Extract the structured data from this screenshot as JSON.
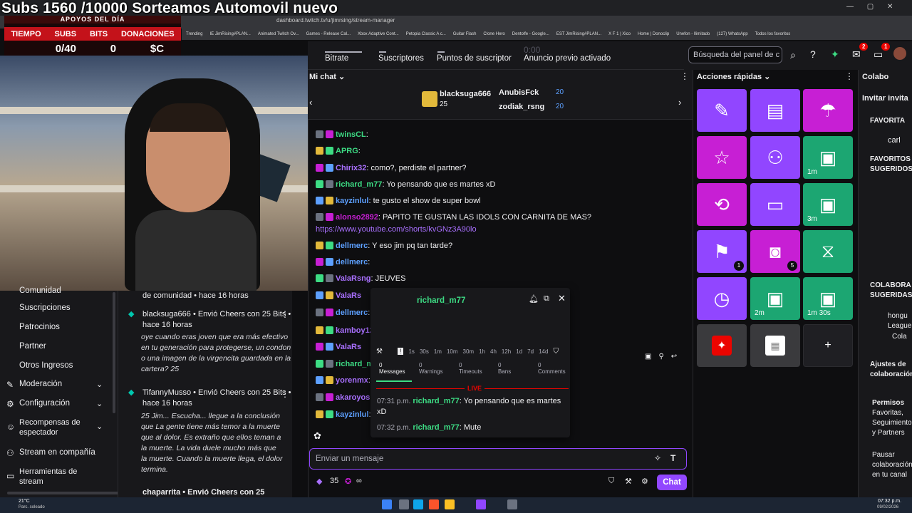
{
  "overlay": {
    "title": "Subs 1560 /10000 Sorteamos Automovil nuevo",
    "header": "APOYOS DEL DÍA",
    "labels": [
      "TIEMPO",
      "SUBS",
      "BITS",
      "DONACIONES"
    ],
    "values": [
      "",
      "0/40",
      "0",
      "$C"
    ]
  },
  "browser": {
    "url": "dashboard.twitch.tv/u/jimrsing/stream-manager",
    "bookmarks": [
      "Trending",
      "IE JimRising#PLAN...",
      "Animated Twitch Ov...",
      "Games - Release Cal...",
      "Xbox Adaptive Cont...",
      "Petopia Classic A c...",
      "Guitar Flash",
      "Clone Hero",
      "Dentolfe - Google...",
      "EST JimRising#PLAN...",
      "X F 1 | Xico",
      "Home | Donoclip",
      "Unefon - Ilimitado",
      "(127) WhatsApp",
      "Todos los favoritos"
    ]
  },
  "stats": {
    "bitrate": "Bitrate",
    "subs": "Suscriptores",
    "points": "Puntos de suscriptor",
    "ad_time": "0:00",
    "ad": "Anuncio previo activado",
    "search_placeholder": "Búsqueda del panel de c",
    "notif_badge_1": "2",
    "notif_badge_2": "1"
  },
  "left_nav": {
    "items": [
      {
        "label": "Comunidad",
        "icon": ""
      },
      {
        "label": "Suscripciones",
        "icon": ""
      },
      {
        "label": "Patrocinios",
        "icon": ""
      },
      {
        "label": "Partner",
        "icon": ""
      },
      {
        "label": "Otros Ingresos",
        "icon": ""
      },
      {
        "label": "Moderación",
        "icon": "✎"
      },
      {
        "label": "Configuración",
        "icon": "⚙"
      },
      {
        "label": "Recompensas de espectador",
        "icon": "☺"
      },
      {
        "label": "Stream en compañía",
        "icon": "⚇"
      },
      {
        "label": "Herramientas de stream",
        "icon": "▭"
      }
    ]
  },
  "activity": {
    "items": [
      {
        "title": "de comunidad • hace 16 horas",
        "quote": ""
      },
      {
        "title": "blacksuga666 • Envió Cheers con 25 Bits • hace 16 horas",
        "quote": "oye cuando eras joven que era más efectivo en tu generación para protegerse, un condon o una imagen de la virgencita guardada en la cartera? 25"
      },
      {
        "title": "TifannyMusso • Envió Cheers con 25 Bits • hace 16 horas",
        "quote": "25 Jim... Escucha... llegue a la conclusión que La gente tiene más temor a la muerte que al dolor. Es extraño que ellos teman a la muerte. La vida duele mucho más que la muerte. Cuando la muerte llega, el dolor termina."
      },
      {
        "title": "chaparrita • Envió Cheers con 25",
        "quote": ""
      }
    ]
  },
  "chat": {
    "title": "Mi chat",
    "hype": [
      {
        "user": "blacksuga666",
        "amount": "25"
      },
      {
        "user": "AnubisFck",
        "amount": "20"
      },
      {
        "user": "zodiak_rsng",
        "amount": "20"
      }
    ],
    "messages": [
      {
        "user": "twinsCL",
        "color": "#3ddc84",
        "text": ":"
      },
      {
        "user": "APRG",
        "color": "#3ddc84",
        "text": ":"
      },
      {
        "user": "Chirix32",
        "color": "#a970ff",
        "text": ": como?, perdiste el partner?"
      },
      {
        "user": "richard_m77",
        "color": "#3ddc84",
        "text": ": Yo pensando que es martes xD"
      },
      {
        "user": "kayzinlul",
        "color": "#5da0ff",
        "text": ": te gusto el show de super bowl"
      },
      {
        "user": "alonso2892",
        "color": "#c71fd4",
        "text": ": PAPITO TE GUSTAN LAS IDOLS CON CARNITA DE MAS?"
      },
      {
        "user": "dellmerc",
        "color": "#5da0ff",
        "text": ": Y eso jim pq tan tarde?"
      },
      {
        "user": "dellmerc",
        "color": "#5da0ff",
        "text": ":"
      },
      {
        "user": "ValaRsng",
        "color": "#a970ff",
        "text": ": JEUVES"
      },
      {
        "user": "ValaRs",
        "color": "#a970ff",
        "text": ""
      },
      {
        "user": "dellmerc",
        "color": "#5da0ff",
        "text": ":"
      },
      {
        "user": "kamboy123",
        "color": "#a970ff",
        "text": ":"
      },
      {
        "user": "ValaRs",
        "color": "#a970ff",
        "text": ""
      },
      {
        "user": "richard_m77",
        "color": "#3ddc84",
        "text": ""
      },
      {
        "user": "yorenmx",
        "color": "#a970ff",
        "text": ":"
      },
      {
        "user": "akaroyoshi",
        "color": "#a970ff",
        "text": ": mut"
      },
      {
        "user": "kayzinlul",
        "color": "#5da0ff",
        "text": ":"
      }
    ],
    "link": "https://www.youtube.com/shorts/kvGNz3A90lo",
    "input_placeholder": "Enviar un mensaje",
    "send_label": "Chat",
    "bits": "35",
    "infinity": "∞"
  },
  "popup": {
    "username": "richard_m77",
    "times": [
      "1s",
      "30s",
      "1m",
      "10m",
      "30m",
      "1h",
      "4h",
      "12h",
      "1d",
      "7d",
      "14d"
    ],
    "tabs": [
      {
        "count": "0",
        "label": "Messages"
      },
      {
        "count": "0",
        "label": "Warnings"
      },
      {
        "count": "0",
        "label": "Timeouts"
      },
      {
        "count": "0",
        "label": "Bans"
      },
      {
        "count": "0",
        "label": "Comments"
      }
    ],
    "live": "LIVE",
    "msgs": [
      {
        "time": "07:31 p.m.",
        "user": "richard_m77",
        "text": ": Yo pensando que es martes xD"
      },
      {
        "time": "07:32 p.m.",
        "user": "richard_m77",
        "text": ": Mute"
      }
    ]
  },
  "quick_actions": {
    "title": "Acciones rápidas",
    "tiles": [
      {
        "icon": "✎",
        "label": "",
        "count": "",
        "color": "purple"
      },
      {
        "icon": "▤",
        "label": "",
        "count": "",
        "color": "purple"
      },
      {
        "icon": "☂",
        "label": "",
        "count": "",
        "color": "magenta"
      },
      {
        "icon": "☆",
        "label": "",
        "count": "",
        "color": "magenta"
      },
      {
        "icon": "⚇",
        "label": "",
        "count": "",
        "color": "purple"
      },
      {
        "icon": "▣",
        "label": "1m",
        "count": "",
        "color": "green"
      },
      {
        "icon": "⟲",
        "label": "",
        "count": "",
        "color": "magenta"
      },
      {
        "icon": "▭",
        "label": "",
        "count": "",
        "color": "purple"
      },
      {
        "icon": "▣",
        "label": "3m",
        "count": "",
        "color": "green"
      },
      {
        "icon": "⚑",
        "label": "",
        "count": "1",
        "color": "purple"
      },
      {
        "icon": "◙",
        "label": "",
        "count": "5",
        "color": "magenta"
      },
      {
        "icon": "⧖",
        "label": "",
        "count": "",
        "color": "green"
      },
      {
        "icon": "◷",
        "label": "",
        "count": "",
        "color": "purple"
      },
      {
        "icon": "▣",
        "label": "2m",
        "count": "",
        "color": "green"
      },
      {
        "icon": "▣",
        "label": "1m 30s",
        "count": "",
        "color": "green"
      },
      {
        "icon": "✦",
        "label": "",
        "count": "",
        "color": "grey"
      },
      {
        "icon": "▦",
        "label": "",
        "count": "",
        "color": "grey"
      },
      {
        "icon": "+",
        "label": "",
        "count": "",
        "color": "grey"
      }
    ]
  },
  "collab": {
    "title": "Colabo",
    "invite": "Invitar invita",
    "favs": "FAVORITA",
    "name1": "carl",
    "favs2": "FAVORITOS SUGERIDOS",
    "collab_sug": "COLABORA SUGERIDAS",
    "name2": "hongu",
    "league": "League",
    "col": "Cola",
    "settings": "Ajustes de colaboración",
    "perms_title": "Permisos",
    "perms": "Favoritas, Seguimiento y Partners",
    "pause": "Pausar colaboración en tu canal"
  },
  "taskbar": {
    "weather_temp": "21°C",
    "weather_desc": "Parc. soleado",
    "time": "07:32 p.m.",
    "date": "09/02/2026"
  }
}
